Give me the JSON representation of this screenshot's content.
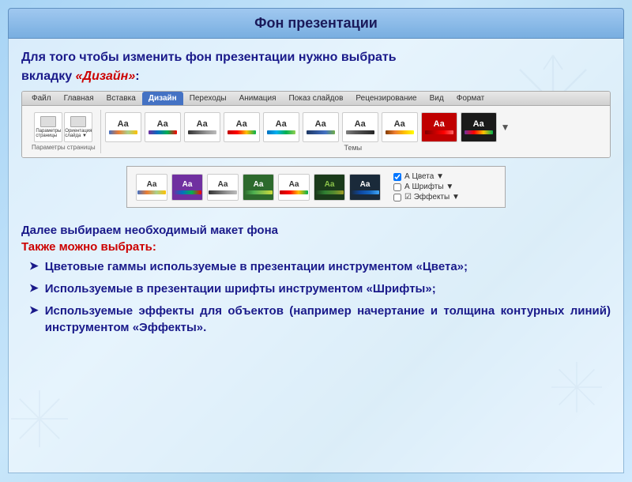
{
  "title": "Фон презентации",
  "intro_line1": "Для  того  чтобы  изменить  фон  презентации  нужно  выбрать",
  "intro_line2_plain": "вкладку ",
  "intro_line2_highlight": "«Дизайн»",
  "intro_line2_end": ":",
  "ribbon": {
    "tabs": [
      "Файл",
      "Главная",
      "Вставка",
      "Дизайн",
      "Переходы",
      "Анимация",
      "Показ слайдов",
      "Рецензирование",
      "Вид",
      "Формат"
    ],
    "active_tab": "Дизайн",
    "left_section_label": "Параметры страницы",
    "icons": [
      "Параметры страницы",
      "Ориентация слайда"
    ],
    "theme_label": "Темы",
    "themes": [
      "t1",
      "t2",
      "t3",
      "t4",
      "t5",
      "t6",
      "t7",
      "t8",
      "t9"
    ]
  },
  "second_ribbon": {
    "themes": [
      "t1",
      "t2",
      "t3",
      "t4",
      "t5",
      "t6",
      "t7"
    ],
    "side_items": [
      "Цвета",
      "Шрифты",
      "Эффекты"
    ]
  },
  "section_text": "Далее выбираем необходимый макет фона",
  "also_text": "Также можно выбрать:",
  "bullets": [
    {
      "arrow": "➤",
      "text": "Цветовые  гаммы  используемые  в  презентации инструментом «Цвета»;"
    },
    {
      "arrow": "➤",
      "text": "Используемые  в  презентации  шрифты  инструментом «Шрифты»;"
    },
    {
      "arrow": "➤",
      "text": "Используемые  эффекты  для  объектов  (например начертание  и  толщина  контурных  линий)  инструментом «Эффекты»."
    }
  ]
}
